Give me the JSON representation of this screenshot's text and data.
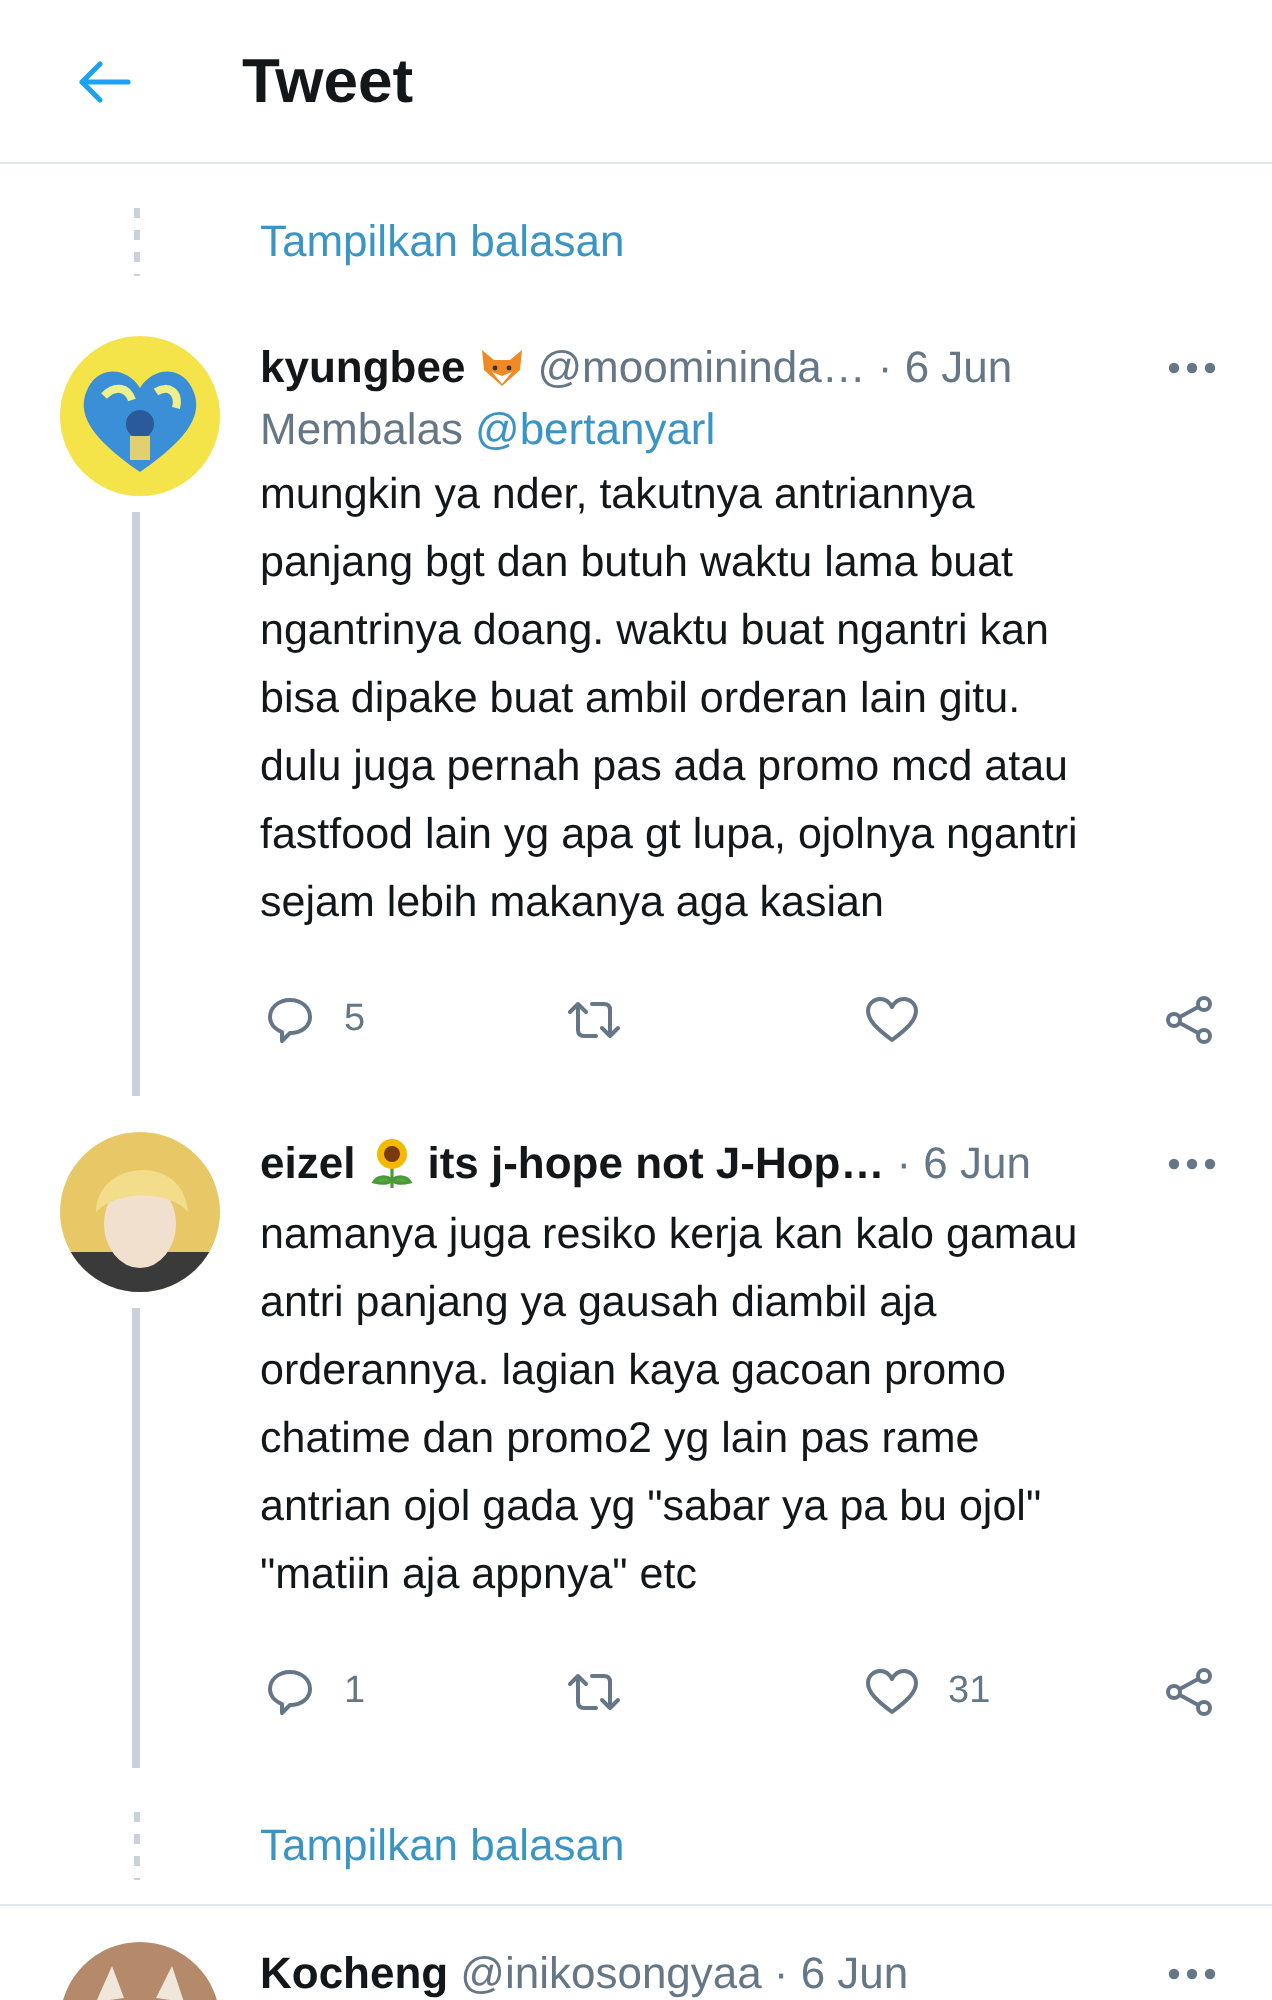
{
  "header": {
    "title": "Tweet"
  },
  "threads": [
    {
      "items": [
        {
          "kind": "more",
          "label": "Tampilkan balasan"
        },
        {
          "kind": "tweet",
          "name": "kyungbee",
          "name_icon": {
            "kind": "fox"
          },
          "handle": "@moomininda…",
          "date": "· 6 Jun",
          "replying": {
            "prefix": "Membalas",
            "handle": "@bertanyarl"
          },
          "text": "mungkin ya nder, takutnya antriannya\npanjang bgt dan butuh waktu lama buat\nngantrinya doang. waktu buat ngantri kan\nbisa dipake buat ambil orderan lain gitu.\ndulu juga pernah pas ada promo mcd atau\nfastfood lain yg apa gt lupa, ojolnya ngantri\nsejam lebih makanya aga kasian",
          "replies": "5"
        },
        {
          "kind": "tweet",
          "name": "eizel",
          "name_icon": {
            "kind": "sunflower"
          },
          "name_after": "its j-hope not J-Hop…",
          "date": "· 6 Jun",
          "text": "namanya juga resiko kerja kan kalo gamau\nantri panjang ya gausah diambil aja\norderannya. lagian kaya gacoan promo\nchatime dan promo2 yg lain pas rame\nantrian ojol gada yg \"sabar ya pa bu ojol\"\n\"matiin aja appnya\" etc",
          "replies": "1",
          "likes": "31"
        },
        {
          "kind": "more",
          "label": "Tampilkan balasan"
        }
      ]
    },
    {
      "items": [
        {
          "kind": "tweet",
          "name": "Kocheng",
          "handle": "@inikosongyaa",
          "date": "· 6 Jun"
        }
      ]
    }
  ]
}
